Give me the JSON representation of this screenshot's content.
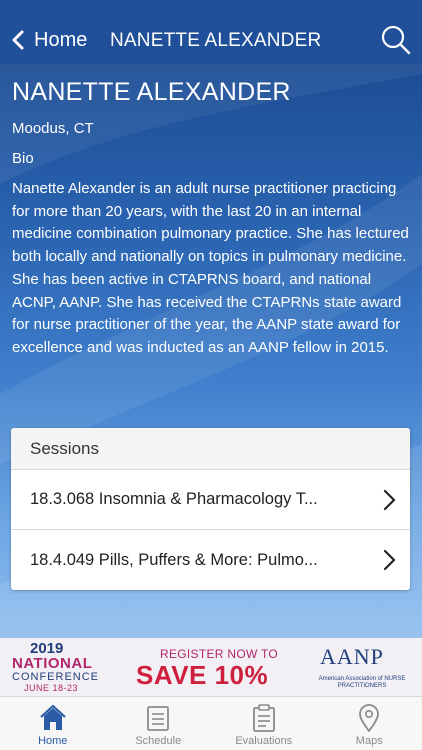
{
  "nav": {
    "back_label": "Home",
    "title": "NANETTE ALEXANDER"
  },
  "speaker": {
    "name": "NANETTE ALEXANDER",
    "location": "Moodus, CT",
    "bio_label": "Bio",
    "bio": "Nanette Alexander is an adult nurse practitioner practicing for more than 20 years, with the last 20 in an internal medicine combination pulmonary practice. She has lectured both locally and nationally on topics in pulmonary medicine. She has been active in CTAPRNS board, and national ACNP, AANP. She has received the CTAPRNs state award for nurse practitioner of the year, the AANP state award for excellence and was inducted as an AANP fellow in 2015."
  },
  "sessions": {
    "header": "Sessions",
    "items": [
      {
        "title": "18.3.068 Insomnia & Pharmacology T..."
      },
      {
        "title": "18.4.049 Pills, Puffers & More: Pulmo..."
      }
    ]
  },
  "banner": {
    "year": "2019",
    "national": "NATIONAL",
    "conference": "CONFERENCE",
    "dates": "JUNE 18-23",
    "register": "REGISTER NOW TO",
    "save": "SAVE 10%",
    "org": "AANP",
    "org_full": "American Association of NURSE PRACTITIONERS"
  },
  "tabs": [
    {
      "label": "Home",
      "icon": "home-icon",
      "active": true
    },
    {
      "label": "Schedule",
      "icon": "schedule-icon",
      "active": false
    },
    {
      "label": "Evaluations",
      "icon": "clipboard-icon",
      "active": false
    },
    {
      "label": "Maps",
      "icon": "map-pin-icon",
      "active": false
    }
  ],
  "colors": {
    "nav_bg": "#20509a",
    "accent": "#2b5ca6",
    "banner_pink": "#b2266a",
    "banner_red": "#cf1f3e"
  }
}
